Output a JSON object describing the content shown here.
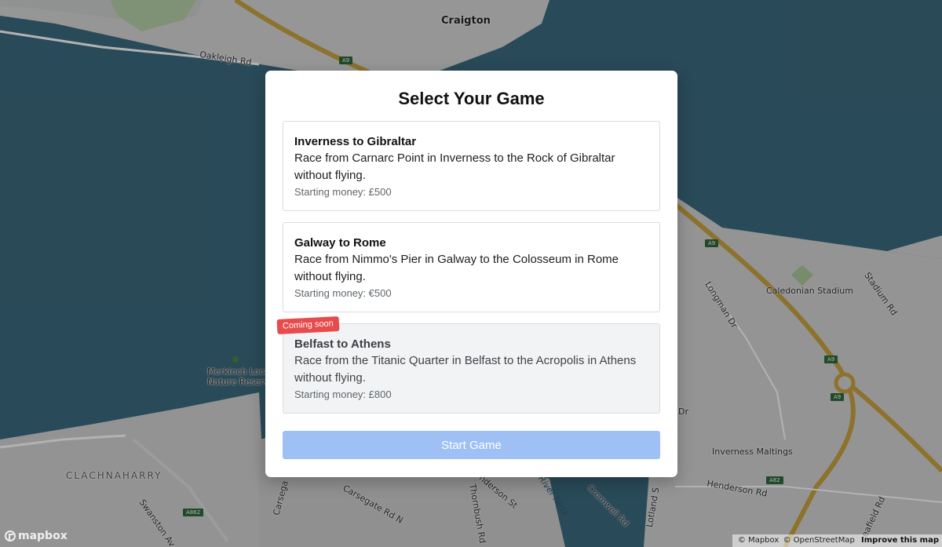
{
  "map": {
    "labels": {
      "craigton": "Craigton",
      "oakleigh": "Oakleigh Rd",
      "merkinch": "Merkinch Local",
      "merkinch2": "Nature Reserve",
      "clachnaharry": "CLACHNAHARRY",
      "caledonian": "Caledonian Stadium",
      "longman": "Longman Dr",
      "stadium": "Stadium Rd",
      "maltings": "Inverness Maltings",
      "henderson": "Henderson Rd",
      "cromwell": "Cromwell Rd",
      "river_ness": "River Ness",
      "carsegate": "Carsegate Rd N",
      "carsegate2": "Carsega",
      "thornbush": "Thornbush Rd",
      "anderson": "nderson St",
      "lotland": "Lotland S",
      "seafield": "eafield Rd",
      "swanston": "Swanston Av",
      "dr": "Dr"
    },
    "shields": {
      "a9_top": "A9",
      "a9_mid": "A9",
      "a9_right": "A9",
      "a9_lower": "A9",
      "a82": "A82",
      "a862": "A862"
    }
  },
  "modal": {
    "title": "Select Your Game",
    "games": [
      {
        "name": "Inverness to Gibraltar",
        "description": "Race from Carnarc Point in Inverness to the Rock of Gibraltar without flying.",
        "money": "Starting money: £500"
      },
      {
        "name": "Galway to Rome",
        "description": "Race from Nimmo's Pier in Galway to the Colosseum in Rome without flying.",
        "money": "Starting money: €500"
      },
      {
        "name": "Belfast to Athens",
        "description": "Race from the Titanic Quarter in Belfast to the Acropolis in Athens without flying.",
        "money": "Starting money: £800",
        "badge": "Coming soon"
      }
    ],
    "start_label": "Start Game"
  },
  "attribution": {
    "mapbox": "© Mapbox",
    "osm": "© OpenStreetMap",
    "improve": "Improve this map"
  },
  "logo": {
    "text": "mapbox"
  }
}
